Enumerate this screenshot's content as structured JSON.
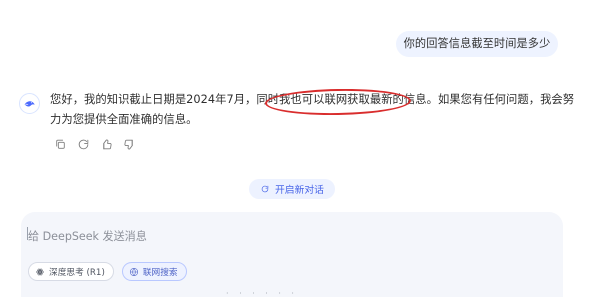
{
  "conversation": {
    "user_message": "你的回答信息截至时间是多少",
    "assistant_message": "您好，我的知识截止日期是2024年7月，同时我也可以联网获取最新的信息。如果您有任何问题，我会努力为您提供全面准确的信息。"
  },
  "actions": {
    "copy": "copy-icon",
    "regenerate": "refresh-icon",
    "like": "thumbs-up-icon",
    "dislike": "thumbs-down-icon"
  },
  "new_chat": {
    "label": "开启新对话"
  },
  "composer": {
    "placeholder": "给 DeepSeek 发送消息",
    "deep_think_label": "深度思考 (R1)",
    "web_search_label": "联网搜索"
  },
  "colors": {
    "highlight_oval": "#d92d2d",
    "user_bubble": "#eef3ff",
    "new_chat_accent": "#4a67e8",
    "composer_background": "#f4f6fb"
  }
}
